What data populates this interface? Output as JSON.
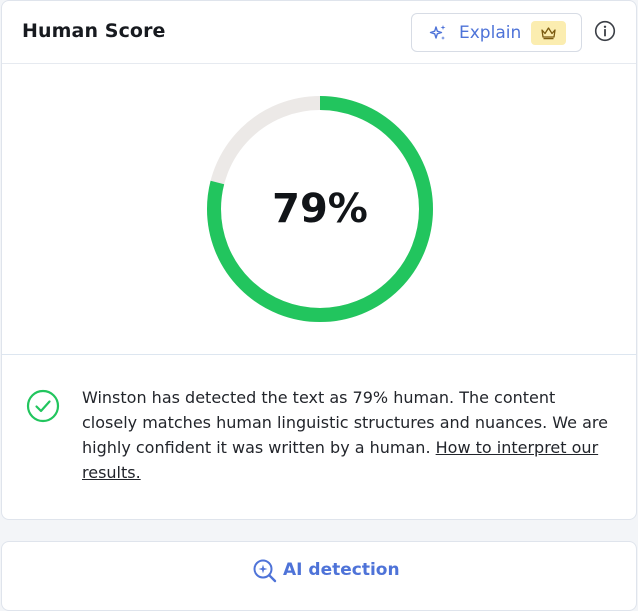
{
  "header": {
    "title": "Human Score",
    "explain_label": "Explain"
  },
  "score": {
    "value": 79,
    "display": "79%"
  },
  "result": {
    "message": "Winston has detected the text as 79% human. The content closely matches human linguistic structures and nuances. We are highly confident it was written by a human.",
    "link_text": "How to interpret our results."
  },
  "footer": {
    "ai_detection_label": "AI detection"
  },
  "colors": {
    "gauge_fill": "#22c55e",
    "gauge_track": "#ece9e7",
    "accent_blue": "#4e73d8",
    "premium_badge": "#fbedb0"
  },
  "icons": {
    "explain": "sparkle-icon",
    "premium": "crown-icon",
    "info": "info-icon",
    "result": "check-circle-icon",
    "ai_detection": "magnifier-ai-icon"
  }
}
